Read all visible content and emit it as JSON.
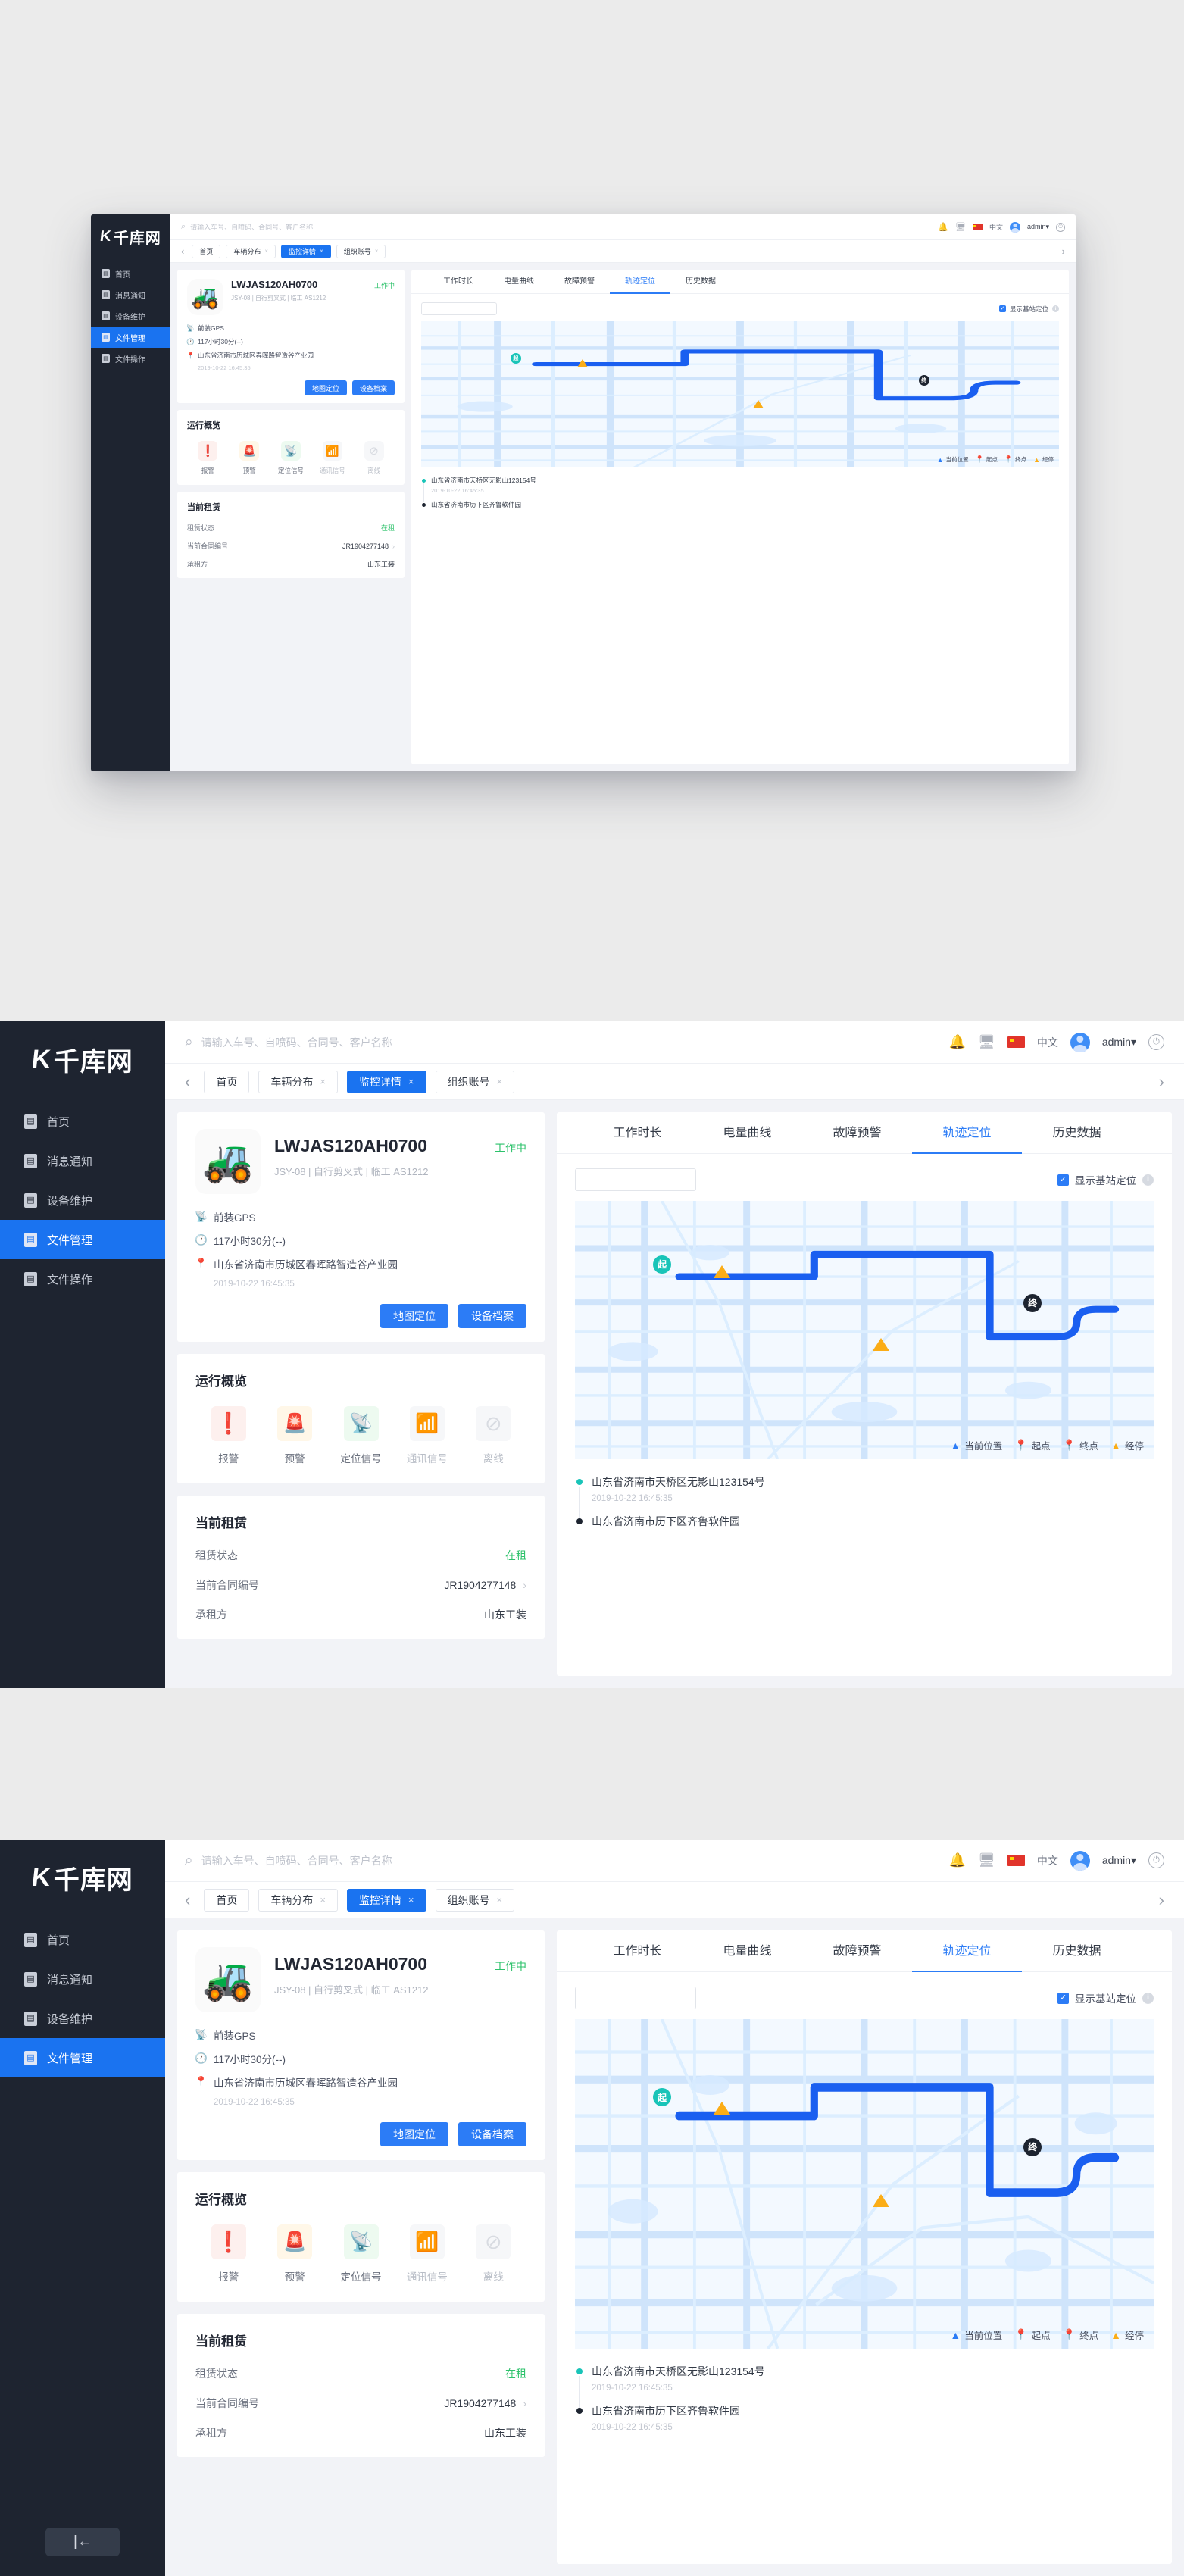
{
  "brand": {
    "logo_mark": "K",
    "name": "千库网"
  },
  "sidebar": {
    "items": [
      {
        "label": "首页",
        "icon": "document-icon",
        "active": false
      },
      {
        "label": "消息通知",
        "icon": "document-icon",
        "active": false
      },
      {
        "label": "设备维护",
        "icon": "document-icon",
        "active": false
      },
      {
        "label": "文件管理",
        "icon": "document-icon",
        "active": true
      },
      {
        "label": "文件操作",
        "icon": "document-icon",
        "active": false
      }
    ],
    "collapse_icon": "collapse-left-icon"
  },
  "topbar": {
    "search_placeholder": "请输入车号、自喷码、合同号、客户名称",
    "search_value": "",
    "bell_icon": "bell-icon",
    "monitor_icon": "monitor-icon",
    "flag_icon": "china-flag-icon",
    "language": "中文",
    "username": "admin",
    "dropdown_caret": "▾",
    "power_icon": "power-icon"
  },
  "tabbar": {
    "back_arrow": "‹",
    "forward_arrow": "›",
    "tabs": [
      {
        "label": "首页",
        "closable": false,
        "active": false
      },
      {
        "label": "车辆分布",
        "closable": true,
        "active": false
      },
      {
        "label": "监控详情",
        "closable": true,
        "active": true
      },
      {
        "label": "组织账号",
        "closable": true,
        "active": false
      }
    ],
    "close_glyph": "×"
  },
  "vehicle": {
    "image_icon": "tractor-icon",
    "title": "LWJAS120AH0700",
    "status": "工作中",
    "subtitle": "JSY-08 | 自行剪叉式 | 临工 AS1212",
    "info_lines": [
      {
        "icon": "satellite-icon",
        "text": "前装GPS"
      },
      {
        "icon": "clock-icon",
        "text": "117小时30分(--)"
      },
      {
        "icon": "location-pin-icon",
        "text": "山东省济南市历城区春晖路智造谷产业园"
      }
    ],
    "timestamp": "2019-10-22 16:45:35",
    "buttons": [
      {
        "label": "地图定位",
        "name": "map-locate-button"
      },
      {
        "label": "设备档案",
        "name": "device-archive-button"
      }
    ]
  },
  "overview": {
    "title": "运行概览",
    "items": [
      {
        "label": "报警",
        "icon": "alarm-icon",
        "color": "#f5402c",
        "bg": "#fdf0ee",
        "enabled": true
      },
      {
        "label": "预警",
        "icon": "siren-icon",
        "color": "#fbad17",
        "bg": "#fff7e8",
        "enabled": true
      },
      {
        "label": "定位信号",
        "icon": "satellite-dish-icon",
        "color": "#29b45c",
        "bg": "#edfaf0",
        "enabled": true
      },
      {
        "label": "通讯信号",
        "icon": "signal-tower-icon",
        "color": "#e3e5e9",
        "bg": "#f6f7f9",
        "enabled": false
      },
      {
        "label": "离线",
        "icon": "offline-icon",
        "color": "#e3e5e9",
        "bg": "#f6f7f9",
        "enabled": false
      }
    ]
  },
  "rental": {
    "title": "当前租赁",
    "rows": [
      {
        "key": "租赁状态",
        "value": "在租",
        "style": "green",
        "chevron": false
      },
      {
        "key": "当前合同编号",
        "value": "JR1904277148",
        "style": "normal",
        "chevron": true
      },
      {
        "key": "承租方",
        "value": "山东工装",
        "style": "normal",
        "chevron": false
      }
    ],
    "chevron_glyph": "›"
  },
  "panel": {
    "tabs": [
      {
        "label": "工作时长",
        "active": false
      },
      {
        "label": "电量曲线",
        "active": false
      },
      {
        "label": "故障预警",
        "active": false
      },
      {
        "label": "轨迹定位",
        "active": true
      },
      {
        "label": "历史数据",
        "active": false
      }
    ],
    "date_value": "",
    "date_placeholder": "",
    "checkbox": {
      "label": "显示基站定位",
      "checked": true,
      "check_glyph": "✓",
      "info_glyph": "i",
      "info_icon": "info-icon"
    }
  },
  "map": {
    "start_marker_label": "起",
    "end_marker_label": "终",
    "stop_marker_label": "P",
    "legend": [
      {
        "label": "当前位置",
        "icon": "navigation-arrow-icon",
        "color": "#2c7cf6"
      },
      {
        "label": "起点",
        "icon": "start-pin-icon",
        "color": "#19c4b8"
      },
      {
        "label": "终点",
        "icon": "end-pin-icon",
        "color": "#1d2430"
      },
      {
        "label": "经停",
        "icon": "parking-triangle-icon",
        "color": "#fbad17"
      }
    ]
  },
  "addresses": [
    {
      "name": "山东省济南市天桥区无影山123154号",
      "time": "2019-10-22 16:45:35",
      "type": "start"
    },
    {
      "name": "山东省济南市历下区齐鲁软件园",
      "time": "2019-10-22 16:45:35",
      "type": "end"
    }
  ]
}
